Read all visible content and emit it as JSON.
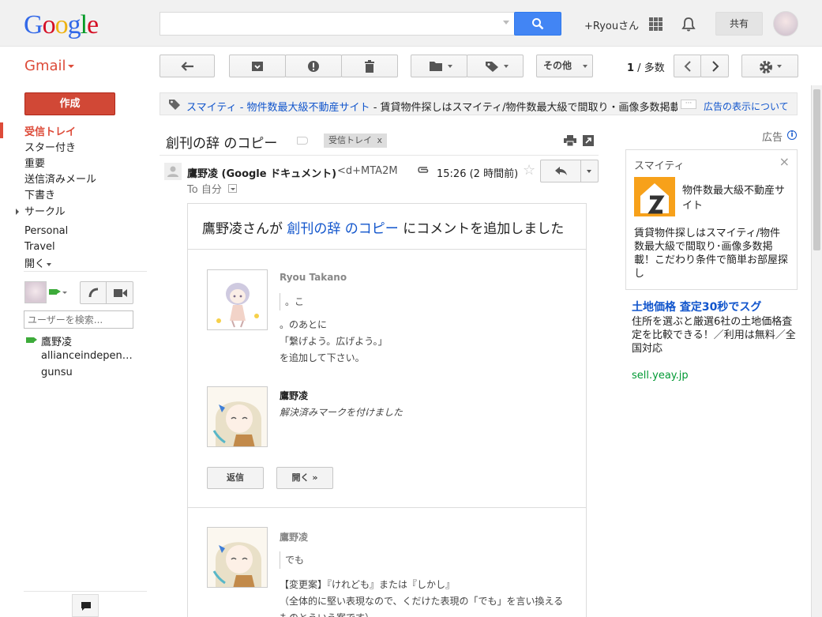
{
  "header": {
    "logo_letters": [
      "G",
      "o",
      "o",
      "g",
      "l",
      "e"
    ],
    "search": {
      "placeholder": "",
      "value": ""
    },
    "user_name": "+Ryouさん",
    "share_label": "共有"
  },
  "toolbar": {
    "app_label": "Gmail",
    "more_label": "その他",
    "page_current": "1",
    "page_total": " / 多数"
  },
  "sidebar": {
    "compose_label": "作成",
    "items": [
      {
        "label": "受信トレイ",
        "active": true
      },
      {
        "label": "スター付き"
      },
      {
        "label": "重要"
      },
      {
        "label": "送信済みメール"
      },
      {
        "label": "下書き"
      },
      {
        "label": "サークル"
      },
      {
        "label": "Personal"
      },
      {
        "label": "Travel"
      },
      {
        "label": "開く"
      }
    ],
    "chat_search_placeholder": "ユーザーを検索...",
    "contacts": [
      "鷹野凌",
      "allianceindependence",
      "gunsu"
    ]
  },
  "adbar": {
    "sponsor": "スマイティ",
    "separator": " - ",
    "headline": "物件数最大級不動産サイト",
    "text": " - 賃貸物件探しはスマイティ/物件数最大級で間取り・画像多数掲載",
    "more": "···",
    "about_label": "広告の表示について"
  },
  "message": {
    "subject": "創刊の辞 のコピー",
    "label_chip": "受信トレイ",
    "label_chip_x": "x",
    "sender_name": "鷹野凌 (Google ドキュメント)",
    "sender_email": "<d+MTA2M",
    "time": "15:26 (2 時間前)",
    "to_line": "To 自分"
  },
  "email_body": {
    "headline_prefix": "鷹野凌さんが ",
    "headline_link": "創刊の辞 のコピー",
    "headline_suffix": " にコメントを追加しました",
    "comment1": {
      "author": "Ryou Takano",
      "quote": "。こ",
      "lines": [
        "。のあとに",
        "「繋げよう。広げよう。」",
        "を追加して下さい。"
      ]
    },
    "comment2": {
      "author": "鷹野凌",
      "action": "解決済みマークを付けました"
    },
    "reply_label": "返信",
    "open_label": "開く »",
    "comment3": {
      "author": "鷹野凌",
      "quote": "でも",
      "lines": [
        "【変更案】『けれども』または『しかし』",
        "（全体的に堅い表現なので、くだけた表現の「でも」を言い換える",
        "ものとういう案です）"
      ]
    }
  },
  "right_ads": {
    "label": "広告",
    "info_icon": "i",
    "card": {
      "title": "スマイティ",
      "close": "×",
      "headline": "物件数最大級不動産サイト",
      "body": "賃貸物件探しはスマイティ/物件数最大級で間取り･画像多数掲載！こだわり条件で簡単お部屋探し"
    },
    "ad2": {
      "title": "土地価格 査定30秒でスグ",
      "body": "住所を選ぶと厳選6社の土地価格査定を比較できる！／利用は無料／全国対応",
      "url": "sell.yeay.jp"
    }
  },
  "icons": {
    "search": "search-icon",
    "apps": "apps-grid-icon",
    "bell": "bell-icon",
    "back": "back-arrow-icon",
    "archive": "archive-icon",
    "spam": "report-spam-icon",
    "delete": "trash-icon",
    "folder": "folder-icon",
    "tag": "tag-icon",
    "prev": "chevron-left-icon",
    "next": "chevron-right-icon",
    "settings": "gear-icon",
    "print": "print-icon",
    "new_window": "new-window-icon",
    "attachment": "paperclip-icon",
    "star": "star-icon",
    "reply": "reply-icon",
    "chat": "chat-bubble-icon",
    "phone": "phone-icon",
    "video": "video-camera-icon"
  },
  "colors": {
    "accent_red": "#dd4b39",
    "link_blue": "#1155cc",
    "search_blue": "#4285f4",
    "url_green": "#009933"
  }
}
